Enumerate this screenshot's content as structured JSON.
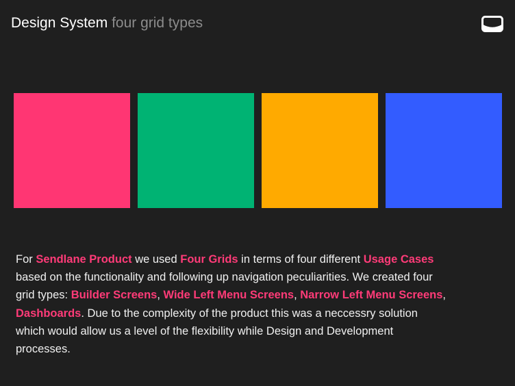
{
  "header": {
    "title_strong": "Design System",
    "title_muted": "four grid types",
    "icon": "mail-icon"
  },
  "colors": {
    "background": "#1f1f1f",
    "highlight": "#ff3b78",
    "muted_text": "#8c8c8c"
  },
  "swatches": [
    {
      "color": "#ff3673"
    },
    {
      "color": "#00b373"
    },
    {
      "color": "#ffaa00"
    },
    {
      "color": "#335cff"
    }
  ],
  "description": {
    "t0": "For ",
    "h0": "Sendlane Product",
    "t1": " we used ",
    "h1": "Four Grids",
    "t2": " in terms of four different ",
    "h2": "Usage Cases",
    "t3": " based on the functionality and following up navigation peculiarities. We created four grid types: ",
    "h3": "Builder Screens",
    "t4": ", ",
    "h4": "Wide Left Menu Screens",
    "t5": ", ",
    "h5": "Narrow Left Menu Screens",
    "t6": ", ",
    "h6": "Dashboards",
    "t7": ". Due to the complexity of the product this was a neccessry solution which would allow us a level of the flexibility while Design and Development processes."
  }
}
